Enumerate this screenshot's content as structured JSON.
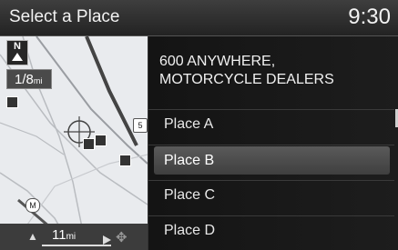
{
  "titlebar": {
    "title": "Select a Place",
    "clock": "9:30"
  },
  "map": {
    "north_label": "N",
    "scale": {
      "value": "1/8",
      "unit": "mi"
    },
    "road_shield_1": "5",
    "road_shield_2": "M",
    "bottom_bar": {
      "distance_value": "11",
      "distance_unit": "mi"
    }
  },
  "list": {
    "header_line1": "600 ANYWHERE,",
    "header_line2": "MOTORCYCLE DEALERS",
    "items": [
      {
        "label": "Place A",
        "selected": false
      },
      {
        "label": "Place B",
        "selected": true
      },
      {
        "label": "Place C",
        "selected": false
      },
      {
        "label": "Place D",
        "selected": false
      }
    ]
  },
  "colors": {
    "selected_row": "#4d4d4d",
    "map_background": "#e9ebee",
    "titlebar": "#2e2e2e"
  }
}
